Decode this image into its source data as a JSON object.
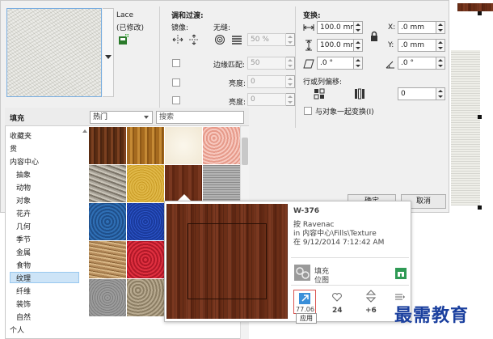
{
  "fill_header": {
    "name": "Lace",
    "modified": "(已修改)"
  },
  "blend": {
    "title": "调和过渡:",
    "mirror_label": "镜像:",
    "seamless_label": "无缝:",
    "seamless_value": "50 %",
    "edge_match_label": "边缘匹配:",
    "edge_match_value": "50",
    "brightness_label": "亮度:",
    "brightness_value": "0",
    "contrast_label": "亮度:",
    "contrast_value": "0"
  },
  "transform": {
    "title": "变换:",
    "width_value": "100.0 mm",
    "height_value": "100.0 mm",
    "x_label": "X:",
    "x_value": ".0 mm",
    "y_label": "Y:",
    "y_value": ".0 mm",
    "skew_value": ".0 °",
    "rotate_value": ".0 °",
    "row_col_offset_label": "行或列偏移:",
    "offset_value": "0",
    "transform_with_object_label": "与对象一起变换(I)"
  },
  "buttons": {
    "ok": "确定",
    "cancel": "取消"
  },
  "library": {
    "title": "填充",
    "filter_value": "热门",
    "search_placeholder": "搜索",
    "tree": [
      "收藏夹",
      "贯",
      "内容中心",
      "抽象",
      "动物",
      "对象",
      "花卉",
      "几何",
      "季节",
      "金属",
      "食物",
      "纹理",
      "纤维",
      "装饰",
      "自然",
      "个人"
    ],
    "selected_index": 11
  },
  "popup": {
    "id": "W-376",
    "author": "按 Ravenac",
    "path": "in 内容中心\\Fills\\Texture",
    "date": "在 9/12/2014 7:12:42 AM",
    "type_line1": "填充",
    "type_line2": "位图",
    "likes": "24",
    "rating": "+6",
    "apply_tooltip": "应用",
    "apply_partial": "77.06"
  },
  "watermark": "最需教育",
  "colors": {
    "accent": "#3a8fd9",
    "selection": "#cde4f7",
    "watermark": "#1a3f9e",
    "tooltip_border": "#d9534f"
  }
}
